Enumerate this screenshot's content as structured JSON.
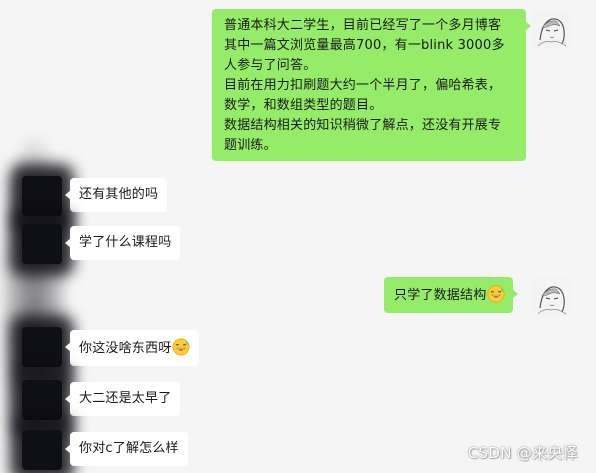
{
  "messages": [
    {
      "side": "right",
      "text": "普通本科大二学生，目前已经写了一个多月博客\n其中一篇文浏览量最高700，有一blink 3000多\n人参与了问答。\n目前在用力扣刷题大约一个半月了，偏哈希表，\n数学，和数组类型的题目。\n数据结构相关的知识稍微了解点，还没有开展专\n题训练。"
    },
    {
      "side": "left",
      "text": "还有其他的吗"
    },
    {
      "side": "left",
      "text": "学了什么课程吗"
    },
    {
      "side": "right",
      "text": "只学了数据结构",
      "emoji": "grinning-sweat-emoji"
    },
    {
      "side": "left",
      "text": "你这没啥东西呀",
      "emoji": "grinning-sweat-emoji"
    },
    {
      "side": "left",
      "text": "大二还是太早了"
    },
    {
      "side": "left",
      "text": "你对c了解怎么样"
    }
  ],
  "watermark": "CSDN @来央怿",
  "colors": {
    "background": "#f5f5f5",
    "self_bubble": "#95ec69",
    "other_bubble": "#ffffff",
    "text": "#191919"
  },
  "icons": {
    "self_avatar": "anime-sketch-avatar",
    "other_avatar": "blurred-avatar"
  }
}
